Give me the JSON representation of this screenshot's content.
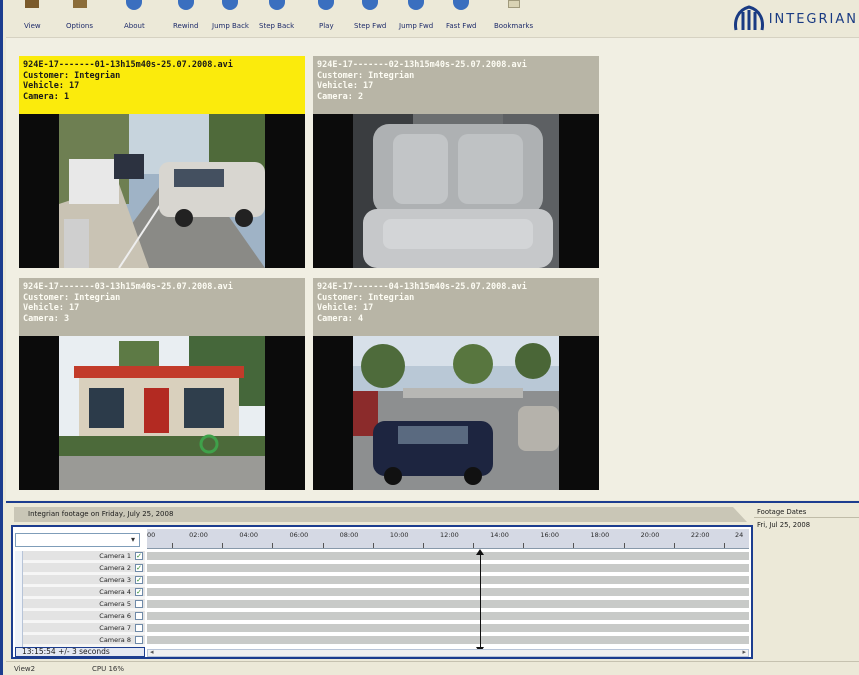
{
  "toolbar": {
    "buttons": [
      {
        "label": "View",
        "icon": "view-icon"
      },
      {
        "label": "Options",
        "icon": "options-icon"
      },
      {
        "label": "About",
        "icon": "about-icon"
      },
      {
        "label": "Rewind",
        "icon": "rewind-icon"
      },
      {
        "label": "Jump Back",
        "icon": "jump-back-icon"
      },
      {
        "label": "Step Back",
        "icon": "step-back-icon"
      },
      {
        "label": "Play",
        "icon": "play-icon"
      },
      {
        "label": "Step Fwd",
        "icon": "step-forward-icon"
      },
      {
        "label": "Jump Fwd",
        "icon": "jump-forward-icon"
      },
      {
        "label": "Fast Fwd",
        "icon": "fast-forward-icon"
      },
      {
        "label": "Bookmarks",
        "icon": "bookmarks-icon"
      }
    ],
    "logo_text": "INTEGRIAN"
  },
  "tiles": [
    {
      "file": "924E-17-------01-13h15m40s-25.07.2008.avi",
      "customer": "Customer: Integrian",
      "vehicle": "Vehicle: 17",
      "camera": "Camera: 1",
      "active": true
    },
    {
      "file": "924E-17-------02-13h15m40s-25.07.2008.avi",
      "customer": "Customer: Integrian",
      "vehicle": "Vehicle: 17",
      "camera": "Camera: 2",
      "active": false
    },
    {
      "file": "924E-17-------03-13h15m40s-25.07.2008.avi",
      "customer": "Customer: Integrian",
      "vehicle": "Vehicle: 17",
      "camera": "Camera: 3",
      "active": false
    },
    {
      "file": "924E-17-------04-13h15m40s-25.07.2008.avi",
      "customer": "Customer: Integrian",
      "vehicle": "Vehicle: 17",
      "camera": "Camera: 4",
      "active": false
    }
  ],
  "timeline": {
    "title": "Integrian footage on Friday, July 25, 2008",
    "ticks": [
      "00",
      "02:00",
      "04:00",
      "06:00",
      "08:00",
      "10:00",
      "12:00",
      "14:00",
      "16:00",
      "18:00",
      "20:00",
      "22:00",
      "24"
    ],
    "cameras": [
      {
        "label": "Camera 1",
        "checked": true
      },
      {
        "label": "Camera 2",
        "checked": true
      },
      {
        "label": "Camera 3",
        "checked": true
      },
      {
        "label": "Camera 4",
        "checked": true
      },
      {
        "label": "Camera 5",
        "checked": false
      },
      {
        "label": "Camera 6",
        "checked": false
      },
      {
        "label": "Camera 7",
        "checked": false
      },
      {
        "label": "Camera 8",
        "checked": false
      }
    ],
    "current_time": "13:15:54 +/- 3 seconds",
    "playhead_hour": 13.26
  },
  "footage_dates": {
    "header": "Footage Dates",
    "items": [
      "Fri, Jul 25, 2008"
    ]
  },
  "status": {
    "view": "View2",
    "cpu": "CPU 16%"
  },
  "colors": {
    "accent_border": "#1c3d8f",
    "active_tile": "#fbeb0c",
    "inactive_tile": "#b8b5a6"
  }
}
